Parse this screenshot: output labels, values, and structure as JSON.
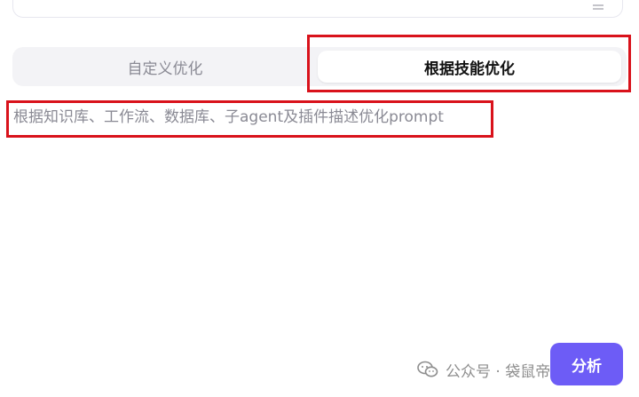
{
  "tabs": {
    "custom_label": "自定义优化",
    "skill_label": "根据技能优化"
  },
  "description": "根据知识库、工作流、数据库、子agent及插件描述优化prompt",
  "actions": {
    "analyze_label": "分析"
  },
  "watermark": {
    "text": "公众号 · 袋鼠帝AI客栈",
    "icon": "wechat-icon"
  },
  "colors": {
    "accent": "#6d5cf6",
    "annotation": "#d9121b",
    "tab_bg": "#f3f3f6",
    "muted_text": "#8a8a94"
  }
}
